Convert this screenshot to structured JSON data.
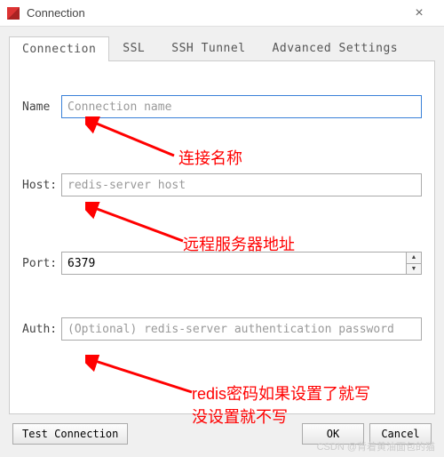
{
  "window": {
    "title": "Connection"
  },
  "tabs": {
    "t0": "Connection",
    "t1": "SSL",
    "t2": "SSH Tunnel",
    "t3": "Advanced Settings"
  },
  "fields": {
    "name_label": "Name",
    "name_placeholder": "Connection name",
    "host_label": "Host:",
    "host_placeholder": "redis-server host",
    "port_label": "Port:",
    "port_value": "6379",
    "auth_label": "Auth:",
    "auth_placeholder": "(Optional) redis-server authentication password"
  },
  "annotations": {
    "name_note": "连接名称",
    "host_note": "远程服务器地址",
    "auth_note_line1": "redis密码如果设置了就写",
    "auth_note_line2": "没设置就不写"
  },
  "buttons": {
    "test": "Test Connection",
    "ok": "OK",
    "cancel": "Cancel"
  },
  "watermark": "CSDN @背着黄油面包的猫"
}
